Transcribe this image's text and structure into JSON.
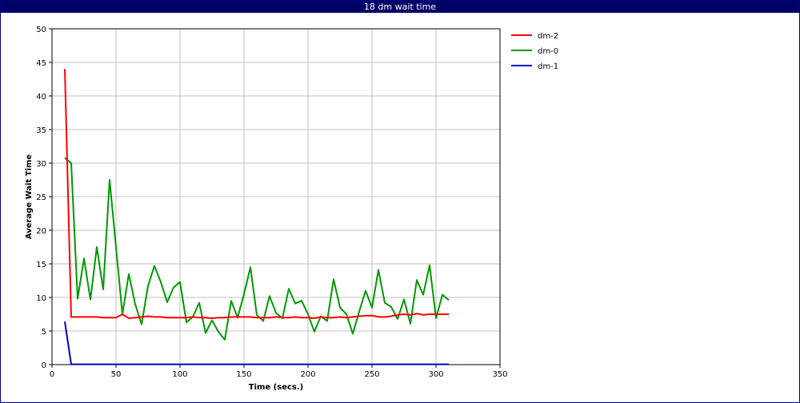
{
  "window": {
    "title": "18 dm wait time"
  },
  "chart_data": {
    "type": "line",
    "title": "18 dm wait time",
    "xlabel": "Time (secs.)",
    "ylabel": "Average Wait Time",
    "xlim": [
      0,
      350
    ],
    "ylim": [
      0,
      50
    ],
    "xticks": [
      0,
      50,
      100,
      150,
      200,
      250,
      300,
      350
    ],
    "yticks": [
      0,
      5,
      10,
      15,
      20,
      25,
      30,
      35,
      40,
      45,
      50
    ],
    "grid": true,
    "legend_position": "right",
    "series": [
      {
        "name": "dm-2",
        "color": "#ff0000",
        "points": [
          [
            10,
            44
          ],
          [
            15,
            7.1
          ],
          [
            20,
            7.1
          ],
          [
            25,
            7.1
          ],
          [
            30,
            7.1
          ],
          [
            35,
            7.1
          ],
          [
            40,
            7.0
          ],
          [
            45,
            7.0
          ],
          [
            50,
            7.0
          ],
          [
            55,
            7.5
          ],
          [
            60,
            6.9
          ],
          [
            65,
            7.0
          ],
          [
            70,
            7.1
          ],
          [
            75,
            7.2
          ],
          [
            80,
            7.1
          ],
          [
            85,
            7.1
          ],
          [
            90,
            7.0
          ],
          [
            95,
            7.0
          ],
          [
            100,
            7.0
          ],
          [
            105,
            7.0
          ],
          [
            110,
            7.1
          ],
          [
            115,
            7.0
          ],
          [
            120,
            7.0
          ],
          [
            125,
            6.9
          ],
          [
            130,
            7.0
          ],
          [
            135,
            7.0
          ],
          [
            140,
            7.1
          ],
          [
            145,
            7.1
          ],
          [
            150,
            7.1
          ],
          [
            155,
            7.1
          ],
          [
            160,
            7.0
          ],
          [
            165,
            7.0
          ],
          [
            170,
            7.0
          ],
          [
            175,
            7.1
          ],
          [
            180,
            7.0
          ],
          [
            185,
            7.0
          ],
          [
            190,
            7.1
          ],
          [
            195,
            7.0
          ],
          [
            200,
            7.0
          ],
          [
            205,
            6.9
          ],
          [
            210,
            7.1
          ],
          [
            215,
            7.0
          ],
          [
            220,
            7.0
          ],
          [
            225,
            7.1
          ],
          [
            230,
            7.0
          ],
          [
            235,
            7.1
          ],
          [
            240,
            7.2
          ],
          [
            245,
            7.3
          ],
          [
            250,
            7.3
          ],
          [
            255,
            7.1
          ],
          [
            260,
            7.1
          ],
          [
            265,
            7.2
          ],
          [
            270,
            7.4
          ],
          [
            275,
            7.5
          ],
          [
            280,
            7.4
          ],
          [
            285,
            7.6
          ],
          [
            290,
            7.4
          ],
          [
            295,
            7.5
          ],
          [
            300,
            7.5
          ],
          [
            305,
            7.5
          ],
          [
            310,
            7.5
          ]
        ]
      },
      {
        "name": "dm-0",
        "color": "#009900",
        "points": [
          [
            10,
            30.8
          ],
          [
            15,
            30.0
          ],
          [
            20,
            9.8
          ],
          [
            25,
            15.8
          ],
          [
            30,
            9.7
          ],
          [
            35,
            17.5
          ],
          [
            40,
            11.2
          ],
          [
            45,
            27.5
          ],
          [
            50,
            17.5
          ],
          [
            55,
            7.5
          ],
          [
            60,
            13.5
          ],
          [
            65,
            9.0
          ],
          [
            70,
            6.0
          ],
          [
            75,
            11.7
          ],
          [
            80,
            14.7
          ],
          [
            85,
            12.3
          ],
          [
            90,
            9.3
          ],
          [
            95,
            11.5
          ],
          [
            100,
            12.3
          ],
          [
            105,
            6.3
          ],
          [
            110,
            7.1
          ],
          [
            115,
            9.2
          ],
          [
            120,
            4.7
          ],
          [
            125,
            6.6
          ],
          [
            130,
            4.9
          ],
          [
            135,
            3.7
          ],
          [
            140,
            9.5
          ],
          [
            145,
            7.0
          ],
          [
            150,
            10.5
          ],
          [
            155,
            14.5
          ],
          [
            160,
            7.4
          ],
          [
            165,
            6.5
          ],
          [
            170,
            10.2
          ],
          [
            175,
            7.7
          ],
          [
            180,
            6.9
          ],
          [
            185,
            11.3
          ],
          [
            190,
            9.1
          ],
          [
            195,
            9.5
          ],
          [
            200,
            7.5
          ],
          [
            205,
            4.9
          ],
          [
            210,
            7.2
          ],
          [
            215,
            6.5
          ],
          [
            220,
            12.7
          ],
          [
            225,
            8.5
          ],
          [
            230,
            7.5
          ],
          [
            235,
            4.6
          ],
          [
            240,
            7.9
          ],
          [
            245,
            11.0
          ],
          [
            250,
            8.5
          ],
          [
            255,
            14.1
          ],
          [
            260,
            9.2
          ],
          [
            265,
            8.6
          ],
          [
            270,
            6.8
          ],
          [
            275,
            9.7
          ],
          [
            280,
            6.1
          ],
          [
            285,
            12.6
          ],
          [
            290,
            10.4
          ],
          [
            295,
            14.8
          ],
          [
            300,
            6.9
          ],
          [
            305,
            10.4
          ],
          [
            310,
            9.6
          ]
        ]
      },
      {
        "name": "dm-1",
        "color": "#0000cc",
        "points": [
          [
            10,
            6.4
          ],
          [
            15,
            0.05
          ],
          [
            20,
            0.05
          ],
          [
            50,
            0.05
          ],
          [
            100,
            0.05
          ],
          [
            150,
            0.05
          ],
          [
            200,
            0.05
          ],
          [
            250,
            0.05
          ],
          [
            300,
            0.05
          ],
          [
            310,
            0.05
          ]
        ]
      }
    ]
  }
}
